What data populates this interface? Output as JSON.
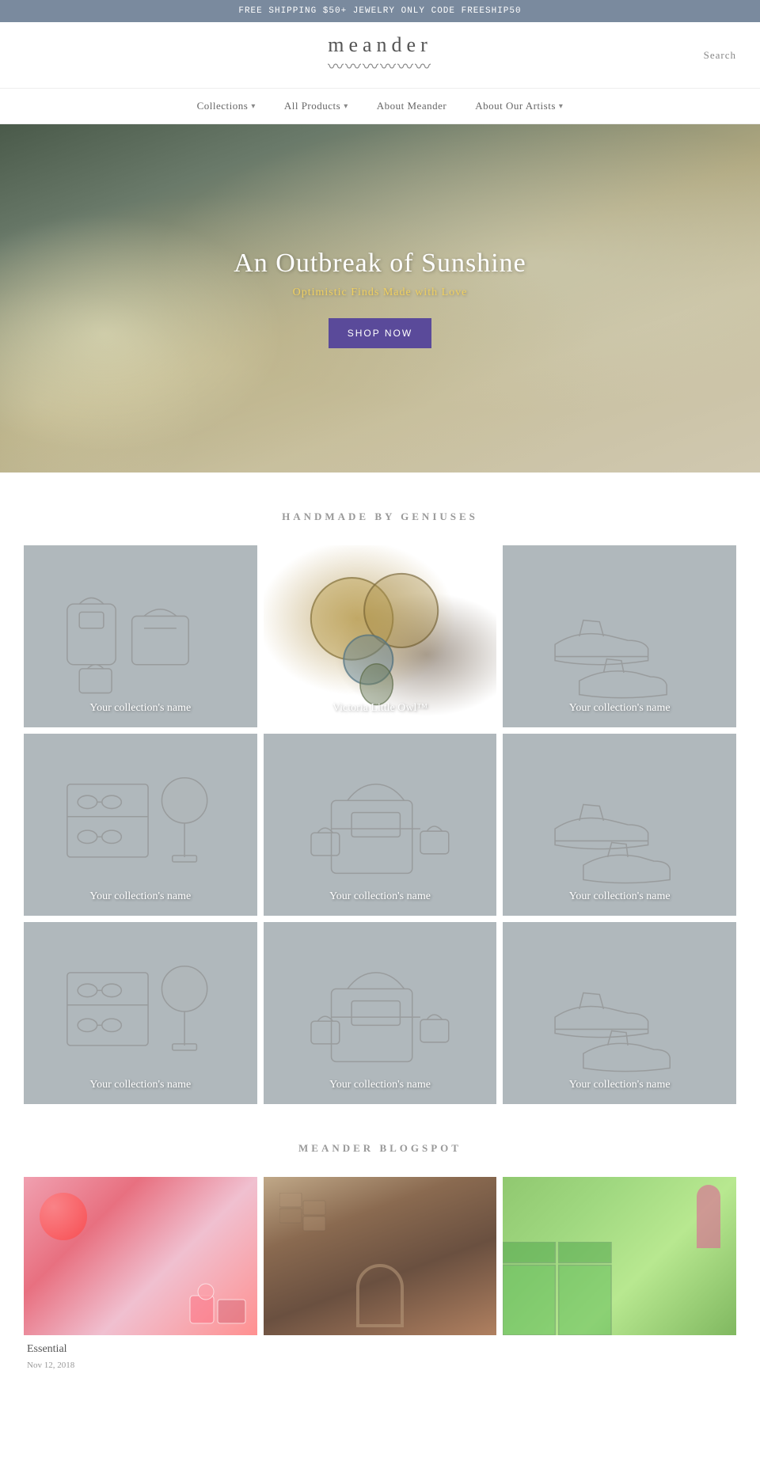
{
  "banner": {
    "text": "FREE SHIPPING $50+ JEWELRY ONLY CODE FREESHIP50"
  },
  "header": {
    "logo": "meander",
    "search_label": "Search"
  },
  "nav": {
    "items": [
      {
        "label": "Collections",
        "has_dropdown": true
      },
      {
        "label": "All Products",
        "has_dropdown": true
      },
      {
        "label": "About Meander",
        "has_dropdown": false
      },
      {
        "label": "About Our Artists",
        "has_dropdown": true
      }
    ]
  },
  "hero": {
    "title": "An Outbreak of Sunshine",
    "subtitle_pre": "Optimistic Finds ",
    "subtitle_highlight": "M",
    "subtitle_post": "ade with Love",
    "cta_label": "SHOP NOW"
  },
  "collections_section": {
    "title": "HANDMADE BY GENIUSES",
    "items": [
      {
        "label": "Your collection's name",
        "type": "bags"
      },
      {
        "label": "Victoria Little Owl™",
        "type": "featured"
      },
      {
        "label": "Your collection's name",
        "type": "shoes"
      },
      {
        "label": "Your collection's name",
        "type": "accessories"
      },
      {
        "label": "Your collection's name",
        "type": "bags2"
      },
      {
        "label": "Your collection's name",
        "type": "shoes2"
      },
      {
        "label": "Your collection's name",
        "type": "accessories2"
      },
      {
        "label": "Your collection's name",
        "type": "bags3"
      },
      {
        "label": "Your collection's name",
        "type": "shoes3"
      }
    ]
  },
  "blog_section": {
    "title": "MEANDER BLOGSPOT",
    "items": [
      {
        "label": "Essential",
        "date": "Nov 12, 2018",
        "type": "pink"
      },
      {
        "label": "",
        "date": "",
        "type": "stone"
      },
      {
        "label": "",
        "date": "",
        "type": "kitchen"
      }
    ]
  }
}
